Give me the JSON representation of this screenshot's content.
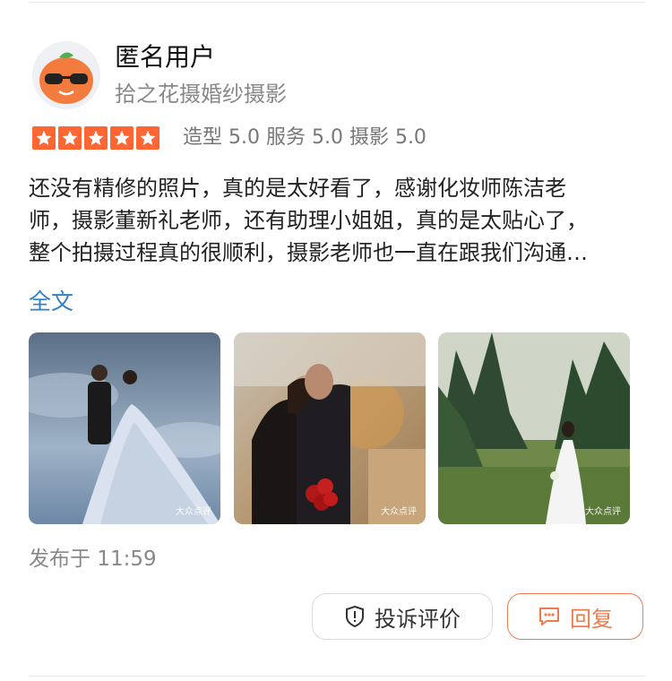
{
  "user": {
    "name": "匿名用户",
    "shop": "拾之花摄婚纱摄影",
    "avatar_icon": "orange-mascot-sunglasses-icon"
  },
  "rating": {
    "stars": 5,
    "scores_text": "造型 5.0  服务 5.0  摄影 5.0"
  },
  "review": {
    "lines": [
      "还没有精修的照片，真的是太好看了，感谢化妆师陈洁老",
      "师，摄影董新礼老师，还有助理小姐姐，真的是太贴心了，",
      "整个拍摄过程真的很顺利，摄影老师也一直在跟我们沟通…"
    ],
    "full_text_link": "全文"
  },
  "photos": [
    {
      "watermark": "大众点评",
      "subject": "wedding-couple-blue-sky"
    },
    {
      "watermark": "大众点评",
      "subject": "couple-embrace-red-roses"
    },
    {
      "watermark": "大众点评",
      "subject": "bride-in-forest"
    }
  ],
  "meta": {
    "published": "发布于 11:59"
  },
  "actions": {
    "complain_label": "投诉评价",
    "reply_label": "回复"
  },
  "colors": {
    "star": "#ff6633",
    "link": "#2f80c8",
    "reply_accent": "#f07a4a"
  }
}
